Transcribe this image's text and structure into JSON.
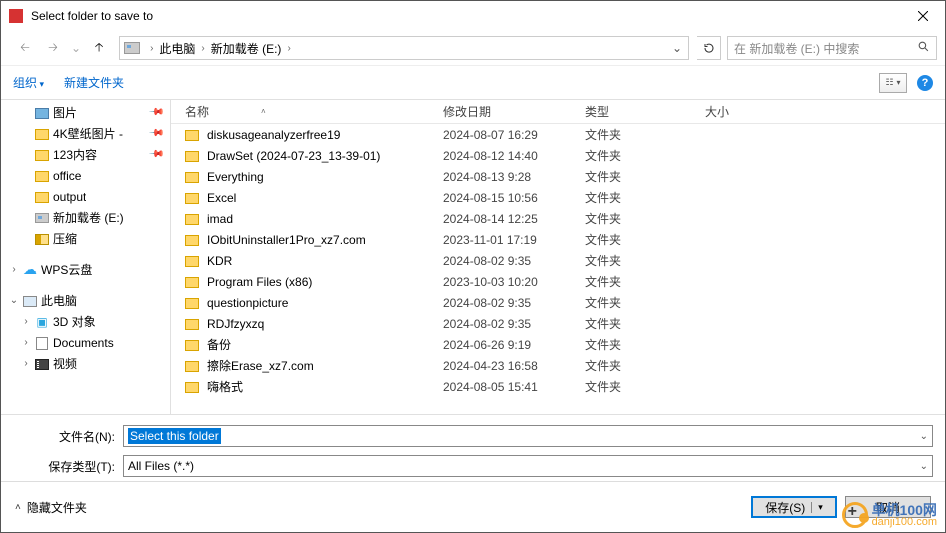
{
  "window": {
    "title": "Select folder to save to"
  },
  "nav": {
    "breadcrumb": [
      "此电脑",
      "新加载卷 (E:)"
    ],
    "search_placeholder": "在 新加载卷 (E:) 中搜索"
  },
  "toolbar": {
    "organize": "组织",
    "new_folder": "新建文件夹"
  },
  "sidebar": [
    {
      "icon": "pic",
      "label": "图片",
      "pinned": true,
      "indent": 1,
      "exp": ""
    },
    {
      "icon": "folder",
      "label": "4K壁纸图片 -",
      "pinned": true,
      "indent": 1,
      "exp": ""
    },
    {
      "icon": "folder",
      "label": "123内容",
      "pinned": true,
      "indent": 1,
      "exp": ""
    },
    {
      "icon": "folder",
      "label": "office",
      "pinned": false,
      "indent": 1,
      "exp": ""
    },
    {
      "icon": "folder",
      "label": "output",
      "pinned": false,
      "indent": 1,
      "exp": ""
    },
    {
      "icon": "drive",
      "label": "新加载卷 (E:)",
      "pinned": false,
      "indent": 1,
      "exp": ""
    },
    {
      "icon": "zip",
      "label": "压缩",
      "pinned": false,
      "indent": 1,
      "exp": ""
    },
    {
      "icon": "spacer",
      "label": "",
      "pinned": false,
      "indent": 0,
      "exp": ""
    },
    {
      "icon": "cloud",
      "label": "WPS云盘",
      "pinned": false,
      "indent": 0,
      "exp": ">"
    },
    {
      "icon": "spacer",
      "label": "",
      "pinned": false,
      "indent": 0,
      "exp": ""
    },
    {
      "icon": "pc",
      "label": "此电脑",
      "pinned": false,
      "indent": 0,
      "exp": "v"
    },
    {
      "icon": "obj3d",
      "label": "3D 对象",
      "pinned": false,
      "indent": 1,
      "exp": ">"
    },
    {
      "icon": "doc",
      "label": "Documents",
      "pinned": false,
      "indent": 1,
      "exp": ">"
    },
    {
      "icon": "vid",
      "label": "视频",
      "pinned": false,
      "indent": 1,
      "exp": ">"
    }
  ],
  "columns": {
    "name": "名称",
    "date": "修改日期",
    "type": "类型",
    "size": "大小"
  },
  "folder_type": "文件夹",
  "files": [
    {
      "name": "diskusageanalyzerfree19",
      "date": "2024-08-07 16:29"
    },
    {
      "name": "DrawSet (2024-07-23_13-39-01)",
      "date": "2024-08-12 14:40"
    },
    {
      "name": "Everything",
      "date": "2024-08-13 9:28"
    },
    {
      "name": "Excel",
      "date": "2024-08-15 10:56"
    },
    {
      "name": "imad",
      "date": "2024-08-14 12:25"
    },
    {
      "name": "IObitUninstaller1Pro_xz7.com",
      "date": "2023-11-01 17:19"
    },
    {
      "name": "KDR",
      "date": "2024-08-02 9:35"
    },
    {
      "name": "Program Files (x86)",
      "date": "2023-10-03 10:20"
    },
    {
      "name": "questionpicture",
      "date": "2024-08-02 9:35"
    },
    {
      "name": "RDJfzyxzq",
      "date": "2024-08-02 9:35"
    },
    {
      "name": "备份",
      "date": "2024-06-26 9:19"
    },
    {
      "name": "擦除Erase_xz7.com",
      "date": "2024-04-23 16:58"
    },
    {
      "name": "嗨格式",
      "date": "2024-08-05 15:41"
    }
  ],
  "form": {
    "filename_label": "文件名(N):",
    "filename_value": "Select this folder",
    "type_label": "保存类型(T):",
    "type_value": "All Files (*.*)"
  },
  "footer": {
    "hide_folders": "隐藏文件夹",
    "save": "保存(S)",
    "cancel": "取消"
  },
  "watermark": {
    "brand": "单机100网",
    "url": "danji100.com"
  }
}
